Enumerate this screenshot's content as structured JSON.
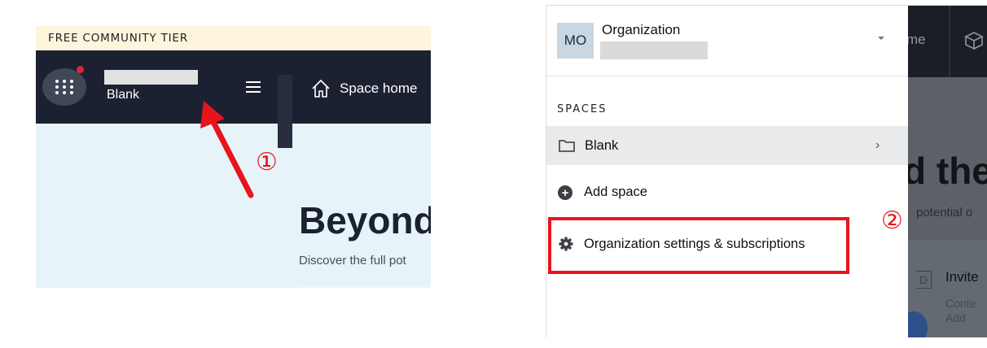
{
  "left_panel": {
    "tier_banner": "FREE COMMUNITY TIER",
    "space_name": "Blank",
    "nav": {
      "space_home": "Space home"
    },
    "hero": {
      "title": "Beyond",
      "subtitle": "Discover the full pot"
    },
    "step_marker": "①"
  },
  "right_panel": {
    "org": {
      "avatar_initials": "MO",
      "name": "Organization"
    },
    "spaces_heading": "SPACES",
    "space_item": {
      "label": "Blank"
    },
    "add_space": "Add space",
    "org_settings": "Organization settings & subscriptions",
    "step_marker": "②",
    "background": {
      "nav_fragment": "me",
      "title_fragment": "d the",
      "subtitle_fragment": "potential o",
      "card_tag": "D",
      "card_title": "Invite",
      "card_line1": "Conte",
      "card_line2": "Add"
    }
  },
  "icons": {
    "app_switcher": "grid-dots-icon",
    "hamburger": "hamburger-menu-icon",
    "home": "home-icon",
    "folder": "folder-icon",
    "chevron": "chevron-right-icon",
    "plus": "plus-circle-icon",
    "gear": "gear-icon"
  },
  "colors": {
    "topbar": "#1c2131",
    "banner": "#fdf6dd",
    "hero_bg": "#e6f3f8",
    "annotation_red": "#e8141c",
    "notification": "#e0243c",
    "selected_item": "#e9eaeb"
  }
}
